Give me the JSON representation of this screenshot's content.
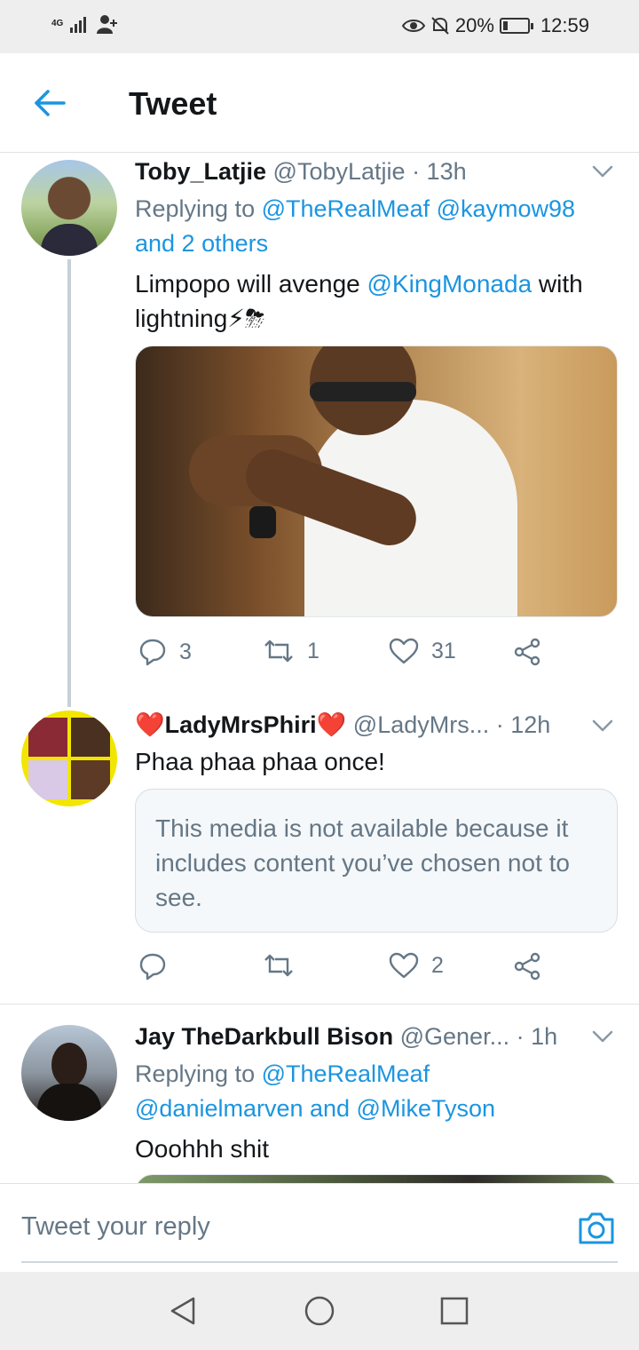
{
  "status_bar": {
    "network": "4G",
    "battery_percent": "20%",
    "battery_level": 0.2,
    "time": "12:59"
  },
  "header": {
    "title": "Tweet"
  },
  "tweets": [
    {
      "display_name": "Toby_Latjie",
      "handle": "@TobyLatjie",
      "time": "· 13h",
      "replying_prefix": "Replying to ",
      "reply_mentions_1": "@TheRealMeaf @kaymow98",
      "reply_mentions_2": "and 2 others",
      "text_before": "Limpopo will avenge ",
      "text_mention": "@KingMonada",
      "text_after": " with",
      "text_line2": "lightning⚡⛈",
      "replies": "3",
      "retweets": "1",
      "likes": "31"
    },
    {
      "display_name": "❤️LadyMrsPhiri❤️",
      "handle": "@LadyMrs...",
      "time": "· 12h",
      "text": "Phaa phaa phaa once!",
      "media_notice": "This media is not available because it includes content you’ve chosen not to see.",
      "replies": "",
      "retweets": "",
      "likes": "2"
    },
    {
      "display_name": "Jay TheDarkbull Bison",
      "handle": "@Gener...",
      "time": "· 1h",
      "replying_prefix": "Replying to ",
      "reply_mentions_1": "@TheRealMeaf",
      "reply_mentions_2": "@danielmarven and @MikeTyson",
      "text": "Ooohhh shit"
    }
  ],
  "reply_bar": {
    "placeholder": "Tweet your reply"
  },
  "colors": {
    "accent": "#1b95e0",
    "secondary_text": "#657786",
    "primary_text": "#14171a"
  },
  "icons": [
    "back-arrow-icon",
    "chevron-down-icon",
    "reply-icon",
    "retweet-icon",
    "like-icon",
    "share-icon",
    "camera-icon",
    "nav-back-icon",
    "nav-home-icon",
    "nav-recents-icon"
  ]
}
